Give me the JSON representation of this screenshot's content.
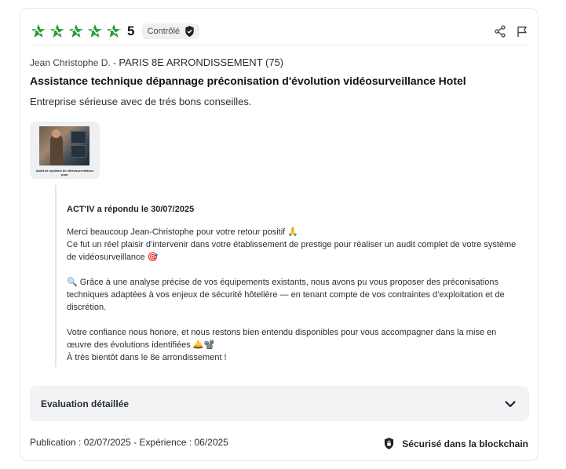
{
  "review": {
    "stars_count": 5,
    "rating_value": "5",
    "badge_label": "Contrôlé",
    "accent_color": "#2a9d3d",
    "author": "Jean Christophe D. - ",
    "location": "PARIS 8E ARRONDISSEMENT (75)",
    "title": "Assistance technique dépannage préconisation d'évolution vidéosurveillance Hotel",
    "comment": "Entreprise sérieuse avec de trés bons conseilles.",
    "thumbnail_caption": "Audit de système de vidéosurveillance pour"
  },
  "reply": {
    "header": "ACT'IV a répondu le 30/07/2025",
    "paragraphs": [
      "Merci beaucoup Jean-Christophe pour votre retour positif 🙏\nCe fut un réel plaisir d’intervenir dans votre établissement de prestige pour réaliser un audit complet de votre système de vidéosurveillance 🎯",
      "🔍 Grâce à une analyse précise de vos équipements existants, nous avons pu vous proposer des préconisations techniques adaptées à vos enjeux de sécurité hôtelière — en tenant compte de vos contraintes d’exploitation et de discrétion.",
      "Votre confiance nous honore, et nous restons bien entendu disponibles pour vous accompagner dans la mise en œuvre des évolutions identifiées 🛎️📽️\nÀ très bientôt dans le 8e arrondissement !"
    ]
  },
  "details": {
    "label": "Evaluation détaillée"
  },
  "footer": {
    "publication": "Publication : 02/07/2025",
    "experience": " - Expérience : 06/2025",
    "secured_label": "Sécurisé dans la blockchain"
  }
}
